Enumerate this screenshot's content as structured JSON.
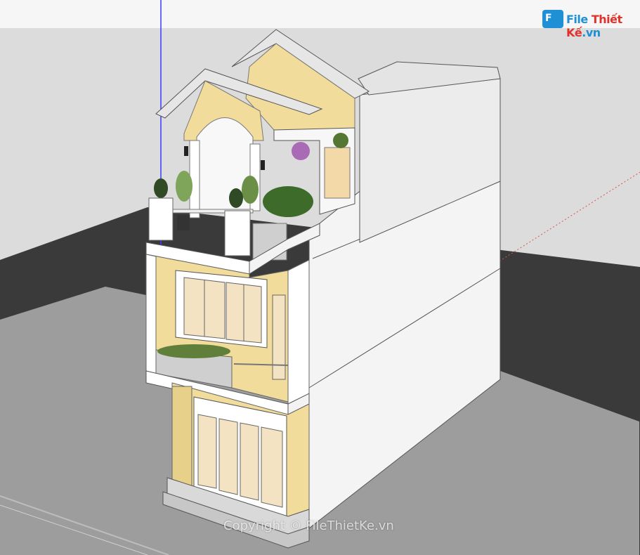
{
  "watermark": {
    "logo_file": "File",
    "logo_thiet_ke": "Thiết Kế",
    "logo_domain": ".vn",
    "copyright": "Copyright © FileThietKe.vn"
  },
  "colors": {
    "sky": "#dcdcdc",
    "ground": "#3a3a3a",
    "lot": "#9a9a9a",
    "wall_white": "#f7f7f7",
    "wall_side": "#e9e9e9",
    "facade_yellow": "#f2dc9b",
    "roof": "#e0e0e0",
    "axis_blue": "#3a3aff",
    "axis_red": "#e05050"
  },
  "icons": {
    "logo": "filethietke-logo-icon",
    "axis_blue": "blue-axis-line",
    "axis_red": "red-dotted-axis-line"
  }
}
